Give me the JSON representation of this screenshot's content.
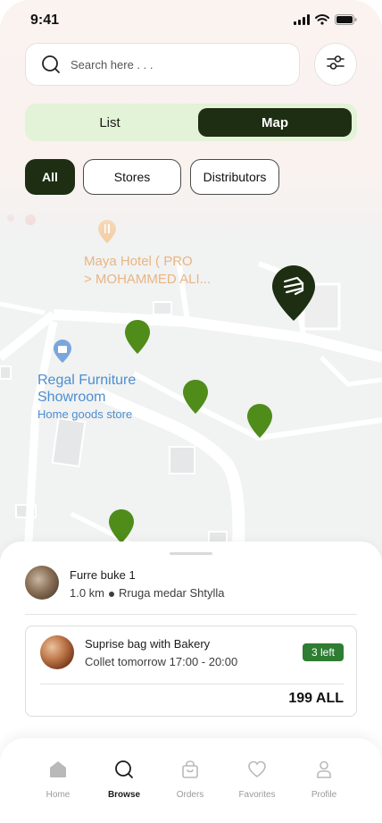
{
  "status_bar": {
    "time": "9:41"
  },
  "search": {
    "placeholder": "Search here . . ."
  },
  "view_toggle": {
    "list_label": "List",
    "map_label": "Map",
    "active": "Map"
  },
  "filters": {
    "chips": [
      "All",
      "Stores",
      "Distributors"
    ],
    "active": "All"
  },
  "map": {
    "pois": [
      {
        "name_line1": "Maya Hotel ( PRO",
        "name_line2": "> MOHAMMED ALI..."
      },
      {
        "name_line1": "Regal Furniture",
        "name_line2": "Showroom",
        "subtitle": "Home goods store"
      }
    ],
    "pin_color": "#4f8c1a",
    "distributor_pin_color": "#1d2e12"
  },
  "store": {
    "name": "Furre buke 1",
    "distance": "1.0 km",
    "address": "Rruga medar Shtylla"
  },
  "offer": {
    "title": "Suprise bag with Bakery",
    "pickup": "Collet tomorrow 17:00 - 20:00",
    "badge": "3 left",
    "price": "199 ALL"
  },
  "tabbar": {
    "tabs": [
      {
        "label": "Home",
        "icon": "home-icon"
      },
      {
        "label": "Browse",
        "icon": "search-icon"
      },
      {
        "label": "Orders",
        "icon": "bag-icon"
      },
      {
        "label": "Favorites",
        "icon": "heart-icon"
      },
      {
        "label": "Profile",
        "icon": "person-icon"
      }
    ],
    "active": "Browse"
  },
  "colors": {
    "accent_dark": "#1d2e12",
    "accent_light": "#e3f3d8",
    "badge": "#2e7d32"
  }
}
